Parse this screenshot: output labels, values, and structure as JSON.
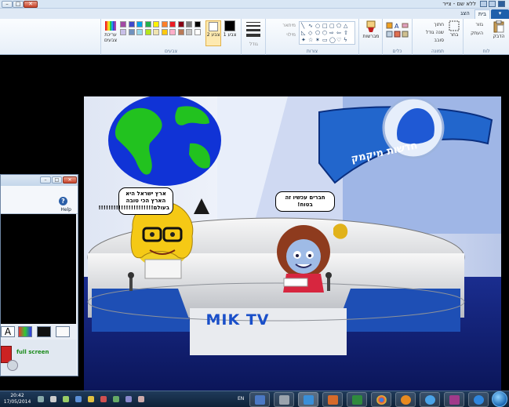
{
  "window": {
    "title": "ללא שם - צייר",
    "close_label": "✕",
    "max_label": "□",
    "min_label": "–"
  },
  "tabs": {
    "file": "▾",
    "home": "בית",
    "view": "הצג"
  },
  "ribbon": {
    "clipboard": {
      "label": "לוח",
      "paste": "הדבק",
      "cut": "גזור",
      "copy": "העתק"
    },
    "image": {
      "label": "תמונה",
      "select": "בחר",
      "crop": "חתוך",
      "resize": "שנה גודל",
      "rotate": "סובב"
    },
    "tools": {
      "label": "כלים"
    },
    "brushes": {
      "label": "מברשות"
    },
    "shapes": {
      "label": "צורות",
      "outline": "מיתאר",
      "fill": "מילוי"
    },
    "size": {
      "label": "גודל"
    },
    "colors": {
      "label": "צבעים",
      "color1": "צבע 1",
      "color2": "צבע 2",
      "edit": "עריכת צבעים",
      "accent": "#3a74c4",
      "palette": [
        "#000000",
        "#7f7f7f",
        "#880015",
        "#ed1c24",
        "#ff7f27",
        "#fff200",
        "#22b14c",
        "#00a2e8",
        "#3f48cc",
        "#a349a4",
        "#ffffff",
        "#c3c3c3",
        "#b97a57",
        "#ffaec9",
        "#ffc90e",
        "#efe4b0",
        "#b5e61d",
        "#99d9ea",
        "#7092be",
        "#c8bfe7"
      ]
    }
  },
  "scene": {
    "bubble_left": "ארץ ישראל היא הארץ הכי טובה בעולם!!!!!!!!!!!!!!!!!!!!!!",
    "bubble_right": "חברים עכשיו זה בטוח!",
    "banner": "חדשות מיקמק",
    "logo": "MIK TV"
  },
  "floatwin": {
    "help": "Help",
    "fullscreen": "full screen",
    "close_label": "✕",
    "max_label": "□",
    "min_label": "–",
    "help_icon": "?"
  },
  "taskbar": {
    "time": "20:42",
    "date": "17/05/2014",
    "lang": "EN"
  }
}
